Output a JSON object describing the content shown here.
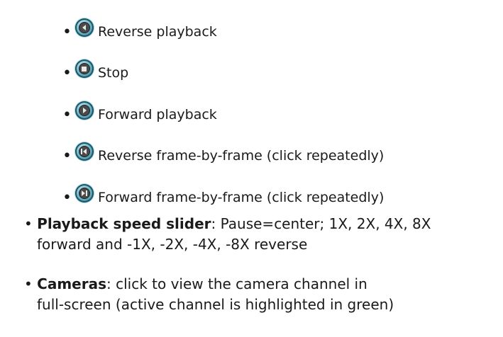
{
  "controls": [
    {
      "icon": "reverse-playback-icon",
      "label": "Reverse playback"
    },
    {
      "icon": "stop-icon",
      "label": "Stop"
    },
    {
      "icon": "forward-playback-icon",
      "label": "Forward playback"
    },
    {
      "icon": "reverse-frame-icon",
      "label": "Reverse frame-by-frame (click repeatedly)"
    },
    {
      "icon": "forward-frame-icon",
      "label": "Forward frame-by-frame (click repeatedly)"
    }
  ],
  "speed_slider": {
    "term": "Playback speed slider",
    "line1": ": Pause=center; 1X, 2X, 4X, 8X",
    "line2": "forward and -1X, -2X, -4X, -8X reverse"
  },
  "cameras": {
    "term": "Cameras",
    "line1": ": click to view the camera channel in",
    "line2": "full-screen (active channel is highlighted in green)"
  },
  "bullet": "•"
}
